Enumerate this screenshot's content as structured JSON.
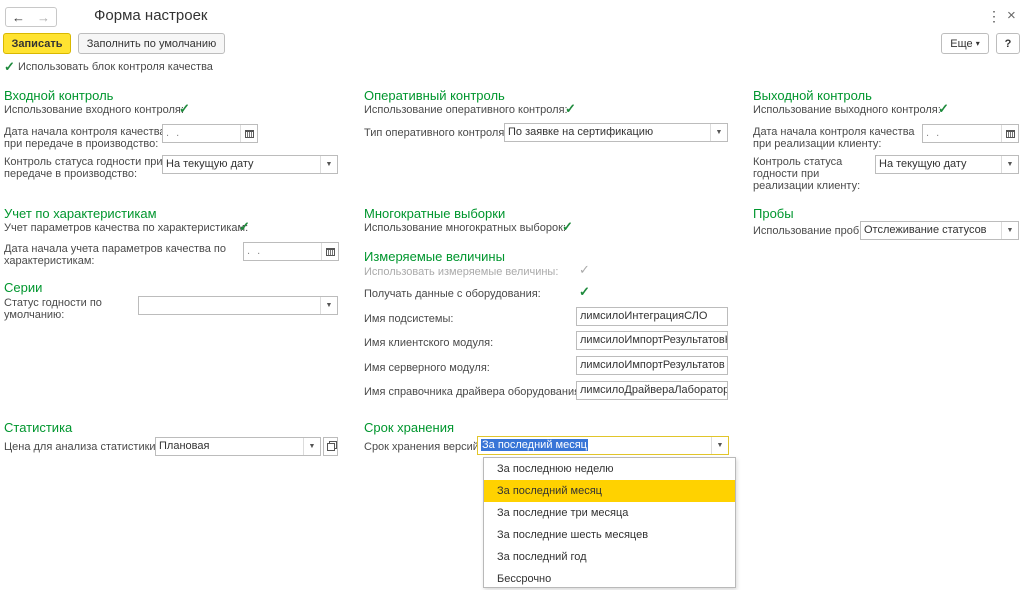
{
  "window": {
    "title": "Форма настроек",
    "back_glyph": "←",
    "forward_glyph": "→",
    "menu_glyph": "⋮",
    "close_glyph": "×"
  },
  "toolbar": {
    "save_label": "Записать",
    "defaults_label": "Заполнить по умолчанию",
    "more_label": "Еще",
    "more_arrow": "▾",
    "help_label": "?"
  },
  "top_option": {
    "label": "Использовать блок контроля качества",
    "checked": true
  },
  "input_control": {
    "title": "Входной контроль",
    "use_label": "Использование входного контроля:",
    "start_date_label_1": "Дата начала контроля качества",
    "start_date_label_2": "при передаче в производство:",
    "start_date_value": ".  .",
    "status_label_1": "Контроль статуса годности при",
    "status_label_2": "передаче в производство:",
    "status_value": "На текущую дату"
  },
  "operative_control": {
    "title": "Оперативный контроль",
    "use_label": "Использование оперативного контроля:",
    "type_label": "Тип оперативного контроля:",
    "type_value": "По заявке на сертификацию"
  },
  "output_control": {
    "title": "Выходной контроль",
    "use_label": "Использование выходного контроля:",
    "start_date_label_1": "Дата начала контроля качества",
    "start_date_label_2": "при реализации клиенту:",
    "start_date_value": ".  .",
    "status_label_1": "Контроль статуса",
    "status_label_2": "годности при",
    "status_label_3": "реализации клиенту:",
    "status_value": "На текущую дату"
  },
  "characteristics": {
    "title": "Учет по характеристикам",
    "use_label": "Учет параметров качества по характеристикам:",
    "start_label_1": "Дата начала учета параметров качества по",
    "start_label_2": "характеристикам:",
    "start_value": ".  ."
  },
  "multiple_samples": {
    "title": "Многократные выборки",
    "use_label": "Использование многократных выборок:"
  },
  "samples": {
    "title": "Пробы",
    "use_label": "Использование проб:",
    "use_value": "Отслеживание статусов"
  },
  "measured": {
    "title": "Измеряемые величины",
    "use_label": "Использовать измеряемые величины:",
    "equipment_label": "Получать данные с оборудования:",
    "subsystem_label": "Имя подсистемы:",
    "subsystem_value": "лимсилоИнтеграцияСЛО",
    "client_module_label": "Имя клиентского модуля:",
    "client_module_value": "лимсилоИмпортРезультатовК",
    "server_module_label": "Имя серверного модуля:",
    "server_module_value": "лимсилоИмпортРезультатов",
    "driver_catalog_label": "Имя справочника драйвера оборудования:",
    "driver_catalog_value": "лимсилоДрайвераЛабораторн"
  },
  "series": {
    "title": "Серии",
    "status_label_1": "Статус годности по",
    "status_label_2": "умолчанию:",
    "status_value": ""
  },
  "statistics": {
    "title": "Статистика",
    "price_label": "Цена для анализа статистики:",
    "price_value": "Плановая"
  },
  "storage": {
    "title": "Срок хранения",
    "versions_label": "Срок хранения версий:",
    "versions_value": "За последний месяц",
    "options": [
      "За последнюю неделю",
      "За последний месяц",
      "За последние три месяца",
      "За последние шесть месяцев",
      "За последний год",
      "Бессрочно"
    ],
    "selected_index": 1
  },
  "colors": {
    "accent_green": "#00962e",
    "primary_yellow": "#ffe331",
    "highlight": "#ffd200",
    "selection_blue": "#3875d7"
  }
}
